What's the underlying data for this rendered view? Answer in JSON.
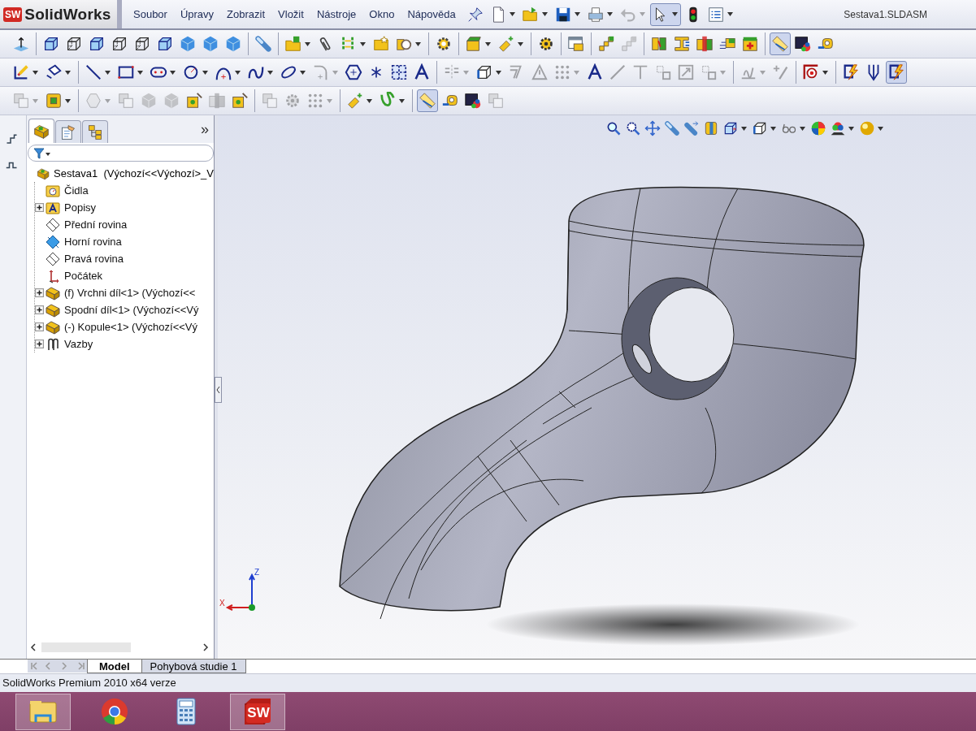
{
  "app": {
    "logo_badge": "SW",
    "logo_text": "SolidWorks"
  },
  "menu": [
    "Soubor",
    "Úpravy",
    "Zobrazit",
    "Vložit",
    "Nástroje",
    "Okno",
    "Nápověda"
  ],
  "quick_access": [
    {
      "kind": "pin",
      "menu": false,
      "disabled": false,
      "pressed": false
    },
    {
      "kind": "new_doc",
      "menu": true,
      "disabled": false,
      "pressed": false
    },
    {
      "kind": "open_folder",
      "menu": true,
      "disabled": false,
      "pressed": false
    },
    {
      "kind": "save",
      "menu": true,
      "disabled": false,
      "pressed": false
    },
    {
      "kind": "printer",
      "menu": true,
      "disabled": false,
      "pressed": false
    },
    {
      "kind": "undo",
      "menu": true,
      "disabled": true,
      "pressed": false
    },
    {
      "kind": "pointer",
      "menu": true,
      "disabled": false,
      "pressed": true
    },
    {
      "kind": "traffic_light",
      "menu": false,
      "disabled": false,
      "pressed": false
    },
    {
      "kind": "checklist",
      "menu": true,
      "disabled": false,
      "pressed": false
    }
  ],
  "window": {
    "title": "Sestava1.SLDASM"
  },
  "toolbars": [
    {
      "groups": [
        {
          "items": [
            {
              "kind": "triad",
              "menu": false,
              "disabled": false,
              "pressed": false
            }
          ]
        },
        {
          "items": [
            {
              "kind": "cube_edges",
              "menu": false,
              "disabled": false,
              "pressed": false
            },
            {
              "kind": "cube_wire",
              "menu": false,
              "disabled": false,
              "pressed": false
            },
            {
              "kind": "cube_edges",
              "menu": false,
              "disabled": false,
              "pressed": false
            },
            {
              "kind": "cube_wire",
              "menu": false,
              "disabled": false,
              "pressed": false
            },
            {
              "kind": "cube_wire",
              "menu": false,
              "disabled": false,
              "pressed": false
            },
            {
              "kind": "cube_edges",
              "menu": false,
              "disabled": false,
              "pressed": false
            },
            {
              "kind": "cube_solid",
              "menu": false,
              "disabled": false,
              "pressed": false
            },
            {
              "kind": "cube_solid",
              "menu": false,
              "disabled": false,
              "pressed": false
            },
            {
              "kind": "cube_solid",
              "menu": false,
              "disabled": false,
              "pressed": false
            }
          ]
        },
        {
          "items": [
            {
              "kind": "capsule",
              "menu": false,
              "disabled": false,
              "pressed": false
            }
          ]
        },
        {
          "items": [
            {
              "kind": "folder_insert",
              "menu": true,
              "disabled": false,
              "pressed": false
            },
            {
              "kind": "paperclip",
              "menu": false,
              "disabled": false,
              "pressed": false
            },
            {
              "kind": "green_bars",
              "menu": true,
              "disabled": false,
              "pressed": false
            },
            {
              "kind": "folder_star",
              "menu": false,
              "disabled": false,
              "pressed": false
            },
            {
              "kind": "ring_part",
              "menu": true,
              "disabled": false,
              "pressed": false
            }
          ]
        },
        {
          "items": [
            {
              "kind": "gear_part",
              "menu": false,
              "disabled": false,
              "pressed": false
            }
          ]
        },
        {
          "items": [
            {
              "kind": "green_box",
              "menu": true,
              "disabled": false,
              "pressed": false
            },
            {
              "kind": "sparkle",
              "menu": true,
              "disabled": false,
              "pressed": false
            }
          ]
        },
        {
          "items": [
            {
              "kind": "gear",
              "menu": false,
              "disabled": false,
              "pressed": false
            }
          ]
        },
        {
          "items": [
            {
              "kind": "window_part",
              "menu": false,
              "disabled": false,
              "pressed": false
            }
          ]
        },
        {
          "items": [
            {
              "kind": "stairs",
              "menu": false,
              "disabled": false,
              "pressed": false
            },
            {
              "kind": "stairs",
              "menu": false,
              "disabled": true,
              "pressed": false
            }
          ]
        },
        {
          "items": [
            {
              "kind": "box_split",
              "menu": false,
              "disabled": false,
              "pressed": false
            },
            {
              "kind": "box_press",
              "menu": false,
              "disabled": false,
              "pressed": false
            },
            {
              "kind": "box_pair",
              "menu": false,
              "disabled": false,
              "pressed": false
            },
            {
              "kind": "box_lines",
              "menu": false,
              "disabled": false,
              "pressed": false
            },
            {
              "kind": "box_plus",
              "menu": false,
              "disabled": false,
              "pressed": false
            }
          ]
        },
        {
          "items": [
            {
              "kind": "ruler",
              "menu": false,
              "disabled": false,
              "pressed": true
            },
            {
              "kind": "picture",
              "menu": false,
              "disabled": false,
              "pressed": false
            },
            {
              "kind": "tape",
              "menu": false,
              "disabled": false,
              "pressed": false
            }
          ]
        }
      ]
    },
    {
      "groups": [
        {
          "items": [
            {
              "kind": "sketch",
              "menu": true,
              "disabled": false,
              "pressed": false
            },
            {
              "kind": "dimension",
              "menu": true,
              "disabled": false,
              "pressed": false
            }
          ]
        },
        {
          "items": [
            {
              "kind": "line",
              "menu": true,
              "disabled": false,
              "pressed": false
            },
            {
              "kind": "rect",
              "menu": true,
              "disabled": false,
              "pressed": false
            },
            {
              "kind": "slot",
              "menu": true,
              "disabled": false,
              "pressed": false
            },
            {
              "kind": "circle",
              "menu": true,
              "disabled": false,
              "pressed": false
            },
            {
              "kind": "arc",
              "menu": true,
              "disabled": false,
              "pressed": false
            },
            {
              "kind": "spline",
              "menu": true,
              "disabled": false,
              "pressed": false
            },
            {
              "kind": "ellipse",
              "menu": true,
              "disabled": false,
              "pressed": false
            },
            {
              "kind": "fillet",
              "menu": true,
              "disabled": true,
              "pressed": false
            },
            {
              "kind": "polygon",
              "menu": false,
              "disabled": false,
              "pressed": false
            },
            {
              "kind": "point",
              "menu": false,
              "disabled": false,
              "pressed": false
            },
            {
              "kind": "grid",
              "menu": false,
              "disabled": false,
              "pressed": false
            },
            {
              "kind": "text_a",
              "menu": false,
              "disabled": false,
              "pressed": false
            }
          ]
        },
        {
          "items": [
            {
              "kind": "mirror",
              "menu": true,
              "disabled": true,
              "pressed": false
            },
            {
              "kind": "cube_outline",
              "menu": true,
              "disabled": false,
              "pressed": false
            },
            {
              "kind": "offset",
              "menu": false,
              "disabled": true,
              "pressed": false
            },
            {
              "kind": "triangle",
              "menu": false,
              "disabled": true,
              "pressed": false
            },
            {
              "kind": "dots",
              "menu": true,
              "disabled": true,
              "pressed": false
            },
            {
              "kind": "text_a",
              "menu": false,
              "disabled": false,
              "pressed": false
            },
            {
              "kind": "diagonal",
              "menu": false,
              "disabled": true,
              "pressed": false
            },
            {
              "kind": "tee",
              "menu": false,
              "disabled": true,
              "pressed": false
            },
            {
              "kind": "box_small",
              "menu": false,
              "disabled": true,
              "pressed": false
            },
            {
              "kind": "box_diag",
              "menu": false,
              "disabled": true,
              "pressed": false
            },
            {
              "kind": "box_small",
              "menu": true,
              "disabled": true,
              "pressed": false
            }
          ]
        },
        {
          "items": [
            {
              "kind": "relation",
              "menu": true,
              "disabled": true,
              "pressed": false
            },
            {
              "kind": "plus_pencil",
              "menu": false,
              "disabled": true,
              "pressed": false
            }
          ]
        },
        {
          "items": [
            {
              "kind": "target",
              "menu": true,
              "disabled": false,
              "pressed": false
            }
          ]
        },
        {
          "items": [
            {
              "kind": "lightning",
              "menu": false,
              "disabled": false,
              "pressed": false
            },
            {
              "kind": "fork",
              "menu": false,
              "disabled": false,
              "pressed": false
            },
            {
              "kind": "lightning",
              "menu": false,
              "disabled": false,
              "pressed": true
            }
          ]
        }
      ]
    },
    {
      "groups": [
        {
          "items": [
            {
              "kind": "box_stack",
              "menu": true,
              "disabled": true,
              "pressed": false
            },
            {
              "kind": "yellow_box",
              "menu": true,
              "disabled": false,
              "pressed": false
            }
          ]
        },
        {
          "items": [
            {
              "kind": "hexagon",
              "menu": true,
              "disabled": true,
              "pressed": false
            },
            {
              "kind": "box_stack",
              "menu": false,
              "disabled": true,
              "pressed": false
            },
            {
              "kind": "cube_solid",
              "menu": false,
              "disabled": true,
              "pressed": false
            },
            {
              "kind": "cube_solid",
              "menu": false,
              "disabled": true,
              "pressed": false
            },
            {
              "kind": "yellow_spark",
              "menu": false,
              "disabled": false,
              "pressed": false
            },
            {
              "kind": "box_pair",
              "menu": false,
              "disabled": true,
              "pressed": false
            },
            {
              "kind": "yellow_spark",
              "menu": false,
              "disabled": false,
              "pressed": false
            }
          ]
        },
        {
          "items": [
            {
              "kind": "box_stack",
              "menu": false,
              "disabled": true,
              "pressed": false
            },
            {
              "kind": "gear",
              "menu": false,
              "disabled": true,
              "pressed": false
            },
            {
              "kind": "dots",
              "menu": true,
              "disabled": true,
              "pressed": false
            }
          ]
        },
        {
          "items": [
            {
              "kind": "sparkle",
              "menu": true,
              "disabled": false,
              "pressed": false
            },
            {
              "kind": "green_curve",
              "menu": true,
              "disabled": false,
              "pressed": false
            }
          ]
        },
        {
          "items": [
            {
              "kind": "ruler",
              "menu": false,
              "disabled": false,
              "pressed": true
            },
            {
              "kind": "tape",
              "menu": false,
              "disabled": false,
              "pressed": false
            },
            {
              "kind": "picture",
              "menu": false,
              "disabled": false,
              "pressed": false
            },
            {
              "kind": "box_stack",
              "menu": false,
              "disabled": true,
              "pressed": false
            }
          ]
        }
      ]
    }
  ],
  "side_strip": [
    {
      "kind": "step_up"
    },
    {
      "kind": "step_pulse"
    }
  ],
  "feature_manager": {
    "tabs": [
      {
        "kind": "assembly",
        "selected": true
      },
      {
        "kind": "properties",
        "selected": false
      },
      {
        "kind": "config",
        "selected": false
      }
    ],
    "expand_glyph": "»",
    "tree": [
      {
        "label": "Sestava1  (Výchozí<<Výchozí>_V",
        "kind": "assembly",
        "expandable": false,
        "expanded": true,
        "children": [
          {
            "label": "Čidla",
            "kind": "sensor_folder",
            "expandable": false,
            "expanded": false
          },
          {
            "label": "Popisy",
            "kind": "annotation_folder",
            "expandable": true,
            "expanded": false
          },
          {
            "label": "Přední rovina",
            "kind": "plane",
            "expandable": false,
            "expanded": false
          },
          {
            "label": "Horní rovina",
            "kind": "plane_filled",
            "expandable": false,
            "expanded": false
          },
          {
            "label": "Pravá rovina",
            "kind": "plane",
            "expandable": false,
            "expanded": false
          },
          {
            "label": "Počátek",
            "kind": "origin",
            "expandable": false,
            "expanded": false
          },
          {
            "label": "(f) Vrchni díl<1> (Výchozí<<",
            "kind": "component",
            "expandable": true,
            "expanded": false
          },
          {
            "label": "Spodní díl<1> (Výchozí<<Vý",
            "kind": "component",
            "expandable": true,
            "expanded": false
          },
          {
            "label": "(-) Kopule<1> (Výchozí<<Vý",
            "kind": "component",
            "expandable": true,
            "expanded": false
          },
          {
            "label": "Vazby",
            "kind": "mates",
            "expandable": true,
            "expanded": false
          }
        ]
      }
    ]
  },
  "view_toolbar": [
    {
      "kind": "zoom_fit",
      "menu": false,
      "disabled": false,
      "pressed": false
    },
    {
      "kind": "zoom_area",
      "menu": false,
      "disabled": false,
      "pressed": false
    },
    {
      "kind": "pan",
      "menu": false,
      "disabled": false,
      "pressed": false
    },
    {
      "kind": "capsule",
      "menu": false,
      "disabled": false,
      "pressed": false
    },
    {
      "kind": "capsule_arrow",
      "menu": false,
      "disabled": false,
      "pressed": false
    },
    {
      "kind": "section",
      "menu": false,
      "disabled": false,
      "pressed": false
    },
    {
      "kind": "view_cube",
      "menu": true,
      "disabled": false,
      "pressed": false
    },
    {
      "kind": "cube_outline",
      "menu": true,
      "disabled": false,
      "pressed": false
    },
    {
      "kind": "glasses",
      "menu": true,
      "disabled": false,
      "pressed": false
    },
    {
      "kind": "color_ball",
      "menu": false,
      "disabled": false,
      "pressed": false
    },
    {
      "kind": "scene",
      "menu": true,
      "disabled": false,
      "pressed": false
    },
    {
      "kind": "light_ball",
      "menu": true,
      "disabled": false,
      "pressed": false
    }
  ],
  "triad": {
    "z_label": "Z",
    "x_label": "X"
  },
  "bottom_tabs": [
    {
      "label": "Model",
      "selected": true
    },
    {
      "label": "Pohybová studie 1",
      "selected": false
    }
  ],
  "status_bar": "SolidWorks Premium 2010 x64 verze",
  "taskbar": [
    {
      "kind": "explorer",
      "selected": true
    },
    {
      "kind": "browser",
      "selected": false
    },
    {
      "kind": "calculator",
      "selected": false
    },
    {
      "kind": "cad_app",
      "selected": true,
      "badge": "SW"
    }
  ]
}
